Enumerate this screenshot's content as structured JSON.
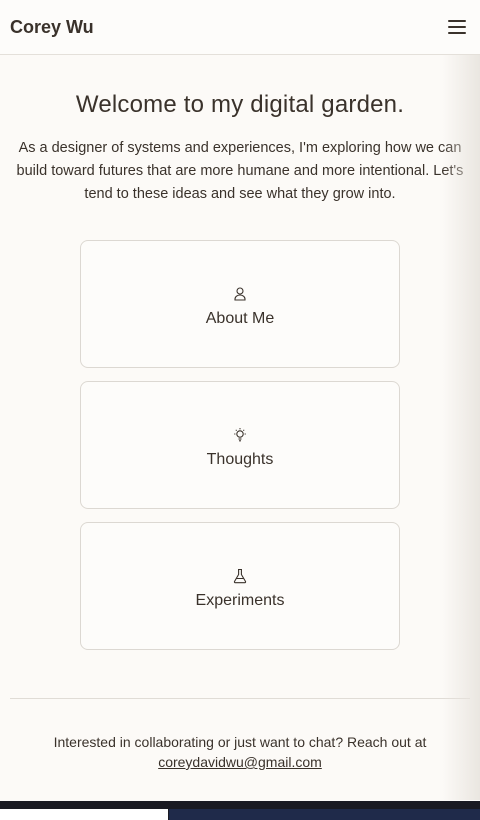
{
  "header": {
    "brand": "Corey Wu",
    "menu_icon": "hamburger-menu-icon"
  },
  "hero": {
    "title": "Welcome to my digital garden.",
    "intro": "As a designer of systems and experiences, I'm exploring how we can build toward futures that are more humane and more intentional. Let's tend to these ideas and see what they grow into."
  },
  "cards": [
    {
      "label": "About Me",
      "icon": "person-icon"
    },
    {
      "label": "Thoughts",
      "icon": "lightbulb-icon"
    },
    {
      "label": "Experiments",
      "icon": "flask-icon"
    }
  ],
  "contact": {
    "text": "Interested in collaborating or just want to chat? Reach out at",
    "email": "coreydavidwu@gmail.com"
  },
  "colors": {
    "background": "#fcfaf7",
    "text": "#3a322b",
    "border": "#dcd8d2"
  }
}
